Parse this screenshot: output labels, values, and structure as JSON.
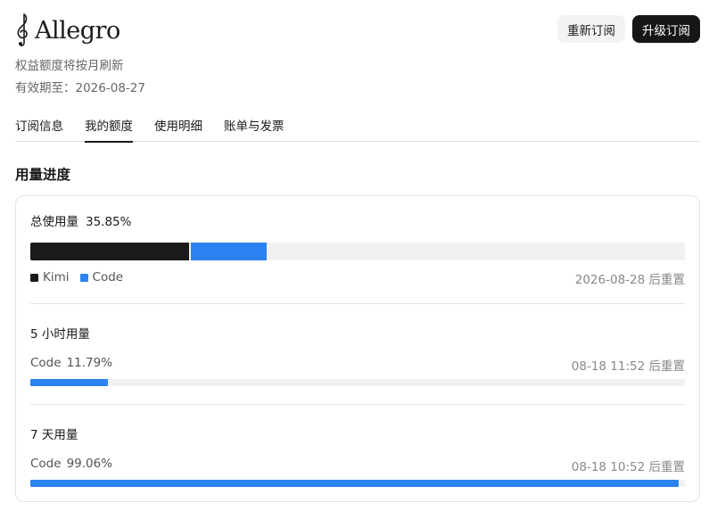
{
  "header": {
    "brand_name": "Allegro",
    "brand_icon": "treble-clef-icon",
    "subtitle": "权益额度将按月刷新",
    "expiry": "有效期至：2026-08-27",
    "renew_label": "重新订阅",
    "upgrade_label": "升级订阅"
  },
  "tabs": [
    {
      "label": "订阅信息",
      "active": false
    },
    {
      "label": "我的额度",
      "active": true
    },
    {
      "label": "使用明细",
      "active": false
    },
    {
      "label": "账单与发票",
      "active": false
    }
  ],
  "usage": {
    "section_title": "用量进度",
    "total": {
      "label": "总使用量",
      "percent_text": "35.85%",
      "segments": [
        {
          "name": "Kimi",
          "percent": 24.25,
          "color": "#1a1a1a"
        },
        {
          "name": "Code",
          "percent": 11.6,
          "color": "#2a83f0"
        }
      ],
      "reset_text": "2026-08-28 后重置"
    },
    "five_hour": {
      "title": "5 小时用量",
      "name": "Code",
      "percent_text": "11.79%",
      "percent": 11.79,
      "reset_text": "08-18 11:52 后重置"
    },
    "seven_day": {
      "title": "7 天用量",
      "name": "Code",
      "percent_text": "99.06%",
      "percent": 99.06,
      "reset_text": "08-18 10:52 后重置"
    }
  },
  "colors": {
    "accent": "#2a83f0",
    "kimi": "#1a1a1a",
    "track": "#f1f1f1"
  }
}
